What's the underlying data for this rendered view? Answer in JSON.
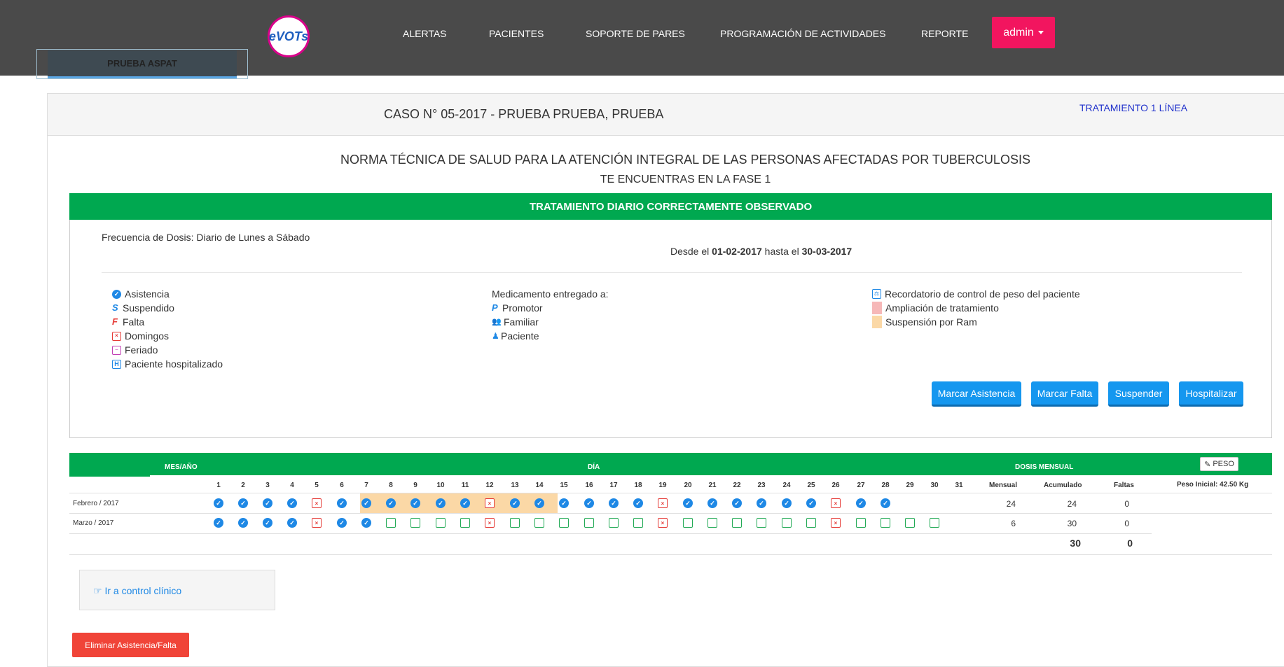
{
  "nav": {
    "logo_text": "eVOTs",
    "items": [
      {
        "label": "ALERTAS"
      },
      {
        "label": "PACIENTES"
      },
      {
        "label": "SOPORTE DE PARES"
      },
      {
        "label": "PROGRAMACIÓN DE ACTIVIDADES"
      },
      {
        "label": "REPORTE"
      }
    ],
    "admin_label": "admin"
  },
  "tab": {
    "label": "PRUEBA ASPAT"
  },
  "header": {
    "case_title": "CASO N° 05-2017 - PRUEBA PRUEBA, PRUEBA",
    "treatment_link": "TRATAMIENTO 1 LÍNEA",
    "norma": "NORMA TÉCNICA DE SALUD PARA LA ATENCIÓN INTEGRAL DE LAS PERSONAS AFECTADAS POR TUBERCULOSIS",
    "fase": "TE ENCUENTRAS EN LA FASE 1"
  },
  "treatment": {
    "bar_title": "TRATAMIENTO DIARIO CORRECTAMENTE OBSERVADO",
    "frequency": "Frecuencia de Dosis: Diario de Lunes a Sábado",
    "desde_prefix": "Desde el",
    "desde_date": "01-02-2017",
    "hasta_prefix": "hasta el",
    "hasta_date": "30-03-2017"
  },
  "legend": {
    "col1": [
      "Asistencia",
      "Suspendido",
      "Falta",
      "Domingos",
      "Feriado",
      "Paciente hospitalizado"
    ],
    "col2_title": "Medicamento entregado a:",
    "col2": [
      "Promotor",
      "Familiar",
      "Paciente"
    ],
    "col3": [
      "Recordatorio de control de peso del paciente",
      "Ampliación de tratamiento",
      "Suspensión por Ram"
    ],
    "colors": {
      "ampliacion": "#f6b8b8",
      "suspension_ram": "#fbd8a6"
    }
  },
  "actions": {
    "marcar_asistencia": "Marcar Asistencia",
    "marcar_falta": "Marcar Falta",
    "suspender": "Suspender",
    "hospitalizar": "Hospitalizar"
  },
  "table": {
    "mes_ano_label": "MES/AÑO",
    "dia_label": "DÍA",
    "dosis_label": "DOSIS MENSUAL",
    "peso_btn": "PESO",
    "mensual_label": "Mensual",
    "acumulado_label": "Acumulado",
    "faltas_label": "Faltas",
    "peso_inicial": "Peso Inicial: 42.50 Kg",
    "days": [
      "1",
      "2",
      "3",
      "4",
      "5",
      "6",
      "7",
      "8",
      "9",
      "10",
      "11",
      "12",
      "13",
      "14",
      "15",
      "16",
      "17",
      "18",
      "19",
      "20",
      "21",
      "22",
      "23",
      "24",
      "25",
      "26",
      "27",
      "28",
      "29",
      "30",
      "31"
    ],
    "rows": [
      {
        "label": "Febrero / 2017",
        "cells": [
          "a",
          "a",
          "a",
          "a",
          "d",
          "a",
          "a",
          "a",
          "a",
          "a",
          "a",
          "d",
          "a",
          "a",
          "a",
          "a",
          "a",
          "a",
          "d",
          "a",
          "a",
          "a",
          "a",
          "a",
          "a",
          "d",
          "a",
          "a",
          "",
          "",
          ""
        ],
        "mensual": "24",
        "acumulado": "24",
        "faltas": "0"
      },
      {
        "label": "Marzo / 2017",
        "cells": [
          "a",
          "a",
          "a",
          "a",
          "d",
          "a",
          "a",
          "e",
          "e",
          "e",
          "e",
          "d",
          "e",
          "e",
          "e",
          "e",
          "e",
          "e",
          "d",
          "e",
          "e",
          "e",
          "e",
          "e",
          "e",
          "d",
          "e",
          "e",
          "e",
          "e",
          ""
        ],
        "mensual": "6",
        "acumulado": "30",
        "faltas": "0"
      }
    ],
    "total_acumulado": "30",
    "total_faltas": "0"
  },
  "footer": {
    "control_link": "Ir a control clínico",
    "eliminar_btn": "Eliminar Asistencia/Falta"
  }
}
